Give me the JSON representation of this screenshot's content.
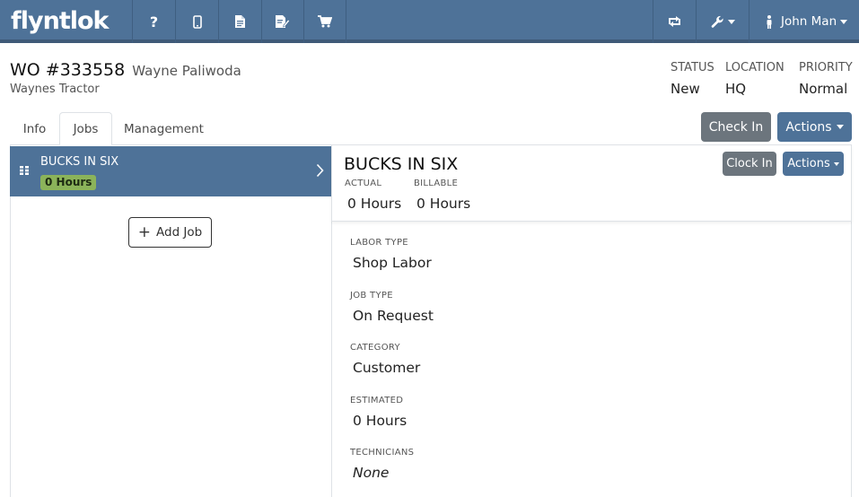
{
  "brand": {
    "logo_text": "flyntlok"
  },
  "nav": {
    "icons": [
      "help-icon",
      "mobile-icon",
      "document-icon",
      "edit-document-icon",
      "cart-icon",
      "swap-icon",
      "wrench-icon"
    ],
    "user_label": "John Man"
  },
  "work_order": {
    "title": "WO #333558",
    "customer": "Wayne Paliwoda",
    "company": "Waynes Tractor",
    "status_label": "STATUS",
    "status_value": "New",
    "location_label": "LOCATION",
    "location_value": "HQ",
    "priority_label": "PRIORITY",
    "priority_value": "Normal"
  },
  "tabs": [
    {
      "label": "Info",
      "active": false
    },
    {
      "label": "Jobs",
      "active": true
    },
    {
      "label": "Management",
      "active": false
    }
  ],
  "header_actions": {
    "check_in": "Check In",
    "actions": "Actions"
  },
  "jobs_list": [
    {
      "name": "BUCKS IN SIX",
      "hours_badge": "0 Hours"
    }
  ],
  "add_job_label": "Add Job",
  "job_detail": {
    "title": "BUCKS IN SIX",
    "actual_label": "ACTUAL",
    "actual_value": "0 Hours",
    "billable_label": "BILLABLE",
    "billable_value": "0 Hours",
    "clock_in": "Clock In",
    "actions": "Actions",
    "fields": [
      {
        "label": "LABOR TYPE",
        "value": "Shop Labor"
      },
      {
        "label": "JOB TYPE",
        "value": "On Request"
      },
      {
        "label": "CATEGORY",
        "value": "Customer"
      },
      {
        "label": "ESTIMATED",
        "value": "0 Hours"
      },
      {
        "label": "TECHNICIANS",
        "value": "None"
      }
    ]
  },
  "colors": {
    "brand_blue": "#4e7298",
    "badge_green": "#8bb35a",
    "button_gray": "#6c757d"
  }
}
